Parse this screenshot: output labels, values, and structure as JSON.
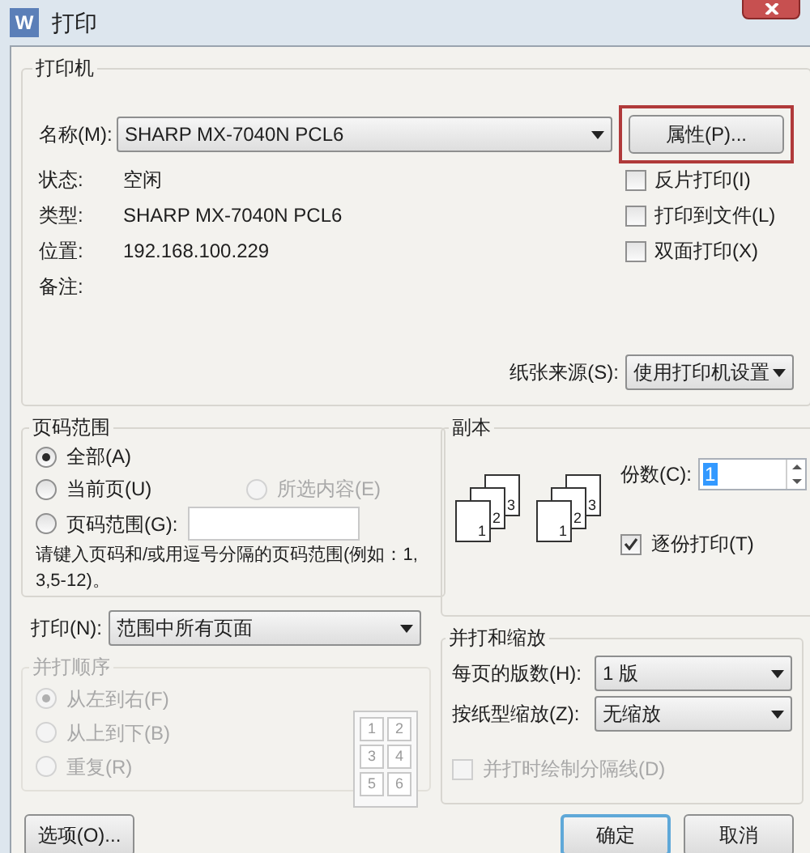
{
  "window": {
    "icon": "W",
    "title": "打印"
  },
  "printer": {
    "title": "打印机",
    "name_label": "名称(M):",
    "name_value": "SHARP MX-7040N PCL6",
    "properties_button": {
      "label": "属性(P)...",
      "highlighted": true
    },
    "info": [
      {
        "label": "状态:",
        "value": "空闲"
      },
      {
        "label": "类型:",
        "value": "SHARP MX-7040N PCL6"
      },
      {
        "label": "位置:",
        "value": "192.168.100.229"
      },
      {
        "label": "备注:"
      }
    ],
    "options": [
      {
        "label": "反片打印(I)",
        "checked": false
      },
      {
        "label": "打印到文件(L)",
        "checked": false
      },
      {
        "label": "双面打印(X)",
        "checked": false
      }
    ],
    "paper_source": {
      "label": "纸张来源(S):",
      "value": "使用打印机设置"
    }
  },
  "page_range": {
    "title": "页码范围",
    "options": [
      {
        "label": "全部(A)",
        "selected": true,
        "disabled": false
      },
      {
        "label": "当前页(U)",
        "selected": false,
        "disabled": false
      },
      {
        "label": "所选内容(E)",
        "selected": false,
        "disabled": true
      },
      {
        "label": "页码范围(G):",
        "selected": false,
        "disabled": false
      }
    ],
    "hint": "请键入页码和/或用逗号分隔的页码范围(例如：1,3,5-12)。"
  },
  "copies": {
    "title": "副本",
    "stacks": [
      {
        "pages": [
          "1",
          "2",
          "3"
        ]
      },
      {
        "pages": [
          "1",
          "2",
          "3"
        ]
      }
    ],
    "count_label": "份数(C):",
    "count": "1",
    "collate": {
      "label": "逐份打印(T)",
      "checked": true
    }
  },
  "print_what": {
    "label": "打印(N):",
    "value": "范围中所有页面"
  },
  "collate_order": {
    "title": "并打顺序",
    "disabled": true,
    "options": [
      {
        "label": "从左到右(F)",
        "selected": true
      },
      {
        "label": "从上到下(B)",
        "selected": false
      },
      {
        "label": "重复(R)",
        "selected": false
      }
    ],
    "preview_pages": [
      "1",
      "2",
      "3",
      "4",
      "5",
      "6"
    ]
  },
  "scaling": {
    "title": "并打和缩放",
    "pages_per_sheet": {
      "label": "每页的版数(H):",
      "value": "1 版"
    },
    "scale": {
      "label": "按纸型缩放(Z):",
      "value": "无缩放"
    },
    "draw_borders": {
      "label": "并打时绘制分隔线(D)",
      "checked": false,
      "disabled": true
    }
  },
  "buttons": [
    {
      "label": "选项(O)...",
      "default": false
    },
    {
      "label": "确定",
      "default": true
    },
    {
      "label": "取消",
      "default": false
    }
  ]
}
